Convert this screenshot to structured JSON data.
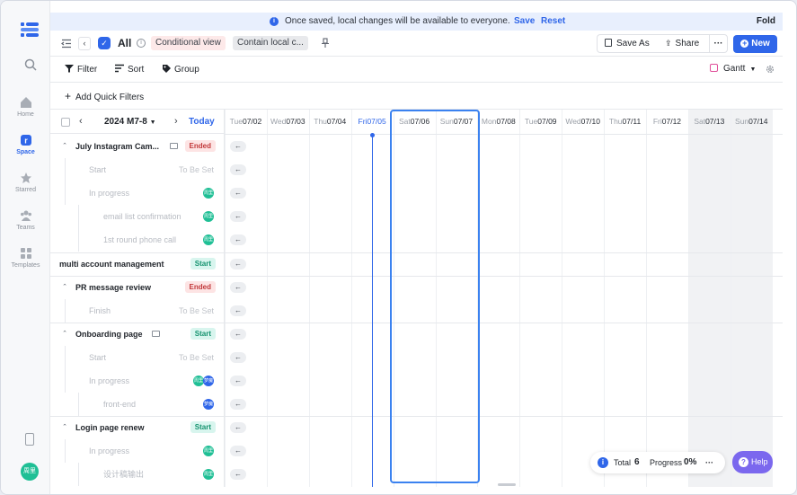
{
  "nav": {
    "home": "Home",
    "space": "Space",
    "starred": "Starred",
    "teams": "Teams",
    "templates": "Templates",
    "user_avatar": "周里"
  },
  "banner": {
    "message": "Once saved, local changes will be available to everyone.",
    "save": "Save",
    "reset": "Reset",
    "fold": "Fold"
  },
  "toolbar": {
    "view_name": "All",
    "chip_conditional": "Conditional view",
    "chip_local": "Contain local c...",
    "save_as": "Save As",
    "share": "Share",
    "new": "New"
  },
  "filters": {
    "filter": "Filter",
    "sort": "Sort",
    "group": "Group",
    "view_type": "Gantt",
    "quick_filters": "Add Quick Filters"
  },
  "calendar": {
    "period": "2024 M7-8",
    "today": "Today",
    "days": [
      {
        "dow": "Tue",
        "date": "07/02",
        "weekend": false,
        "today": false
      },
      {
        "dow": "Wed",
        "date": "07/03",
        "weekend": false,
        "today": false
      },
      {
        "dow": "Thu",
        "date": "07/04",
        "weekend": false,
        "today": false
      },
      {
        "dow": "Fri",
        "date": "07/05",
        "weekend": false,
        "today": true
      },
      {
        "dow": "Sat",
        "date": "07/06",
        "weekend": true,
        "today": false
      },
      {
        "dow": "Sun",
        "date": "07/07",
        "weekend": true,
        "today": false
      },
      {
        "dow": "Mon",
        "date": "07/08",
        "weekend": false,
        "today": false
      },
      {
        "dow": "Tue",
        "date": "07/09",
        "weekend": false,
        "today": false
      },
      {
        "dow": "Wed",
        "date": "07/10",
        "weekend": false,
        "today": false
      },
      {
        "dow": "Thu",
        "date": "07/11",
        "weekend": false,
        "today": false
      },
      {
        "dow": "Fri",
        "date": "07/12",
        "weekend": false,
        "today": false
      },
      {
        "dow": "Sat",
        "date": "07/13",
        "weekend": true,
        "today": false
      },
      {
        "dow": "Sun",
        "date": "07/14",
        "weekend": true,
        "today": false
      }
    ]
  },
  "tasks": [
    {
      "label": "July Instagram Cam...",
      "kind": "parent",
      "status": "Ended",
      "comment": true
    },
    {
      "label": "Start",
      "kind": "child",
      "tbs": "To Be Set"
    },
    {
      "label": "In progress",
      "kind": "child",
      "avatars": [
        "g"
      ]
    },
    {
      "label": "email list confirmation",
      "kind": "sub",
      "avatars": [
        "g"
      ]
    },
    {
      "label": "1st round phone call",
      "kind": "sub",
      "avatars": [
        "g"
      ]
    },
    {
      "label": "multi account management",
      "kind": "solo",
      "status": "Start"
    },
    {
      "label": "PR message review",
      "kind": "parent",
      "status": "Ended"
    },
    {
      "label": "Finish",
      "kind": "child",
      "tbs": "To Be Set"
    },
    {
      "label": "Onboarding page",
      "kind": "parent",
      "status": "Start",
      "comment": true
    },
    {
      "label": "Start",
      "kind": "child",
      "tbs": "To Be Set"
    },
    {
      "label": "In progress",
      "kind": "child",
      "avatars": [
        "g",
        "b"
      ]
    },
    {
      "label": "front-end",
      "kind": "sub",
      "avatars": [
        "b"
      ]
    },
    {
      "label": "Login page renew",
      "kind": "parent",
      "status": "Start"
    },
    {
      "label": "In progress",
      "kind": "child",
      "avatars": [
        "g"
      ]
    },
    {
      "label": "设计稿输出",
      "kind": "sub",
      "avatars": [
        "g"
      ]
    }
  ],
  "footer": {
    "total_label": "Total",
    "total_value": "6",
    "progress_label": "Progress",
    "progress_value": "0%",
    "help": "Help"
  }
}
